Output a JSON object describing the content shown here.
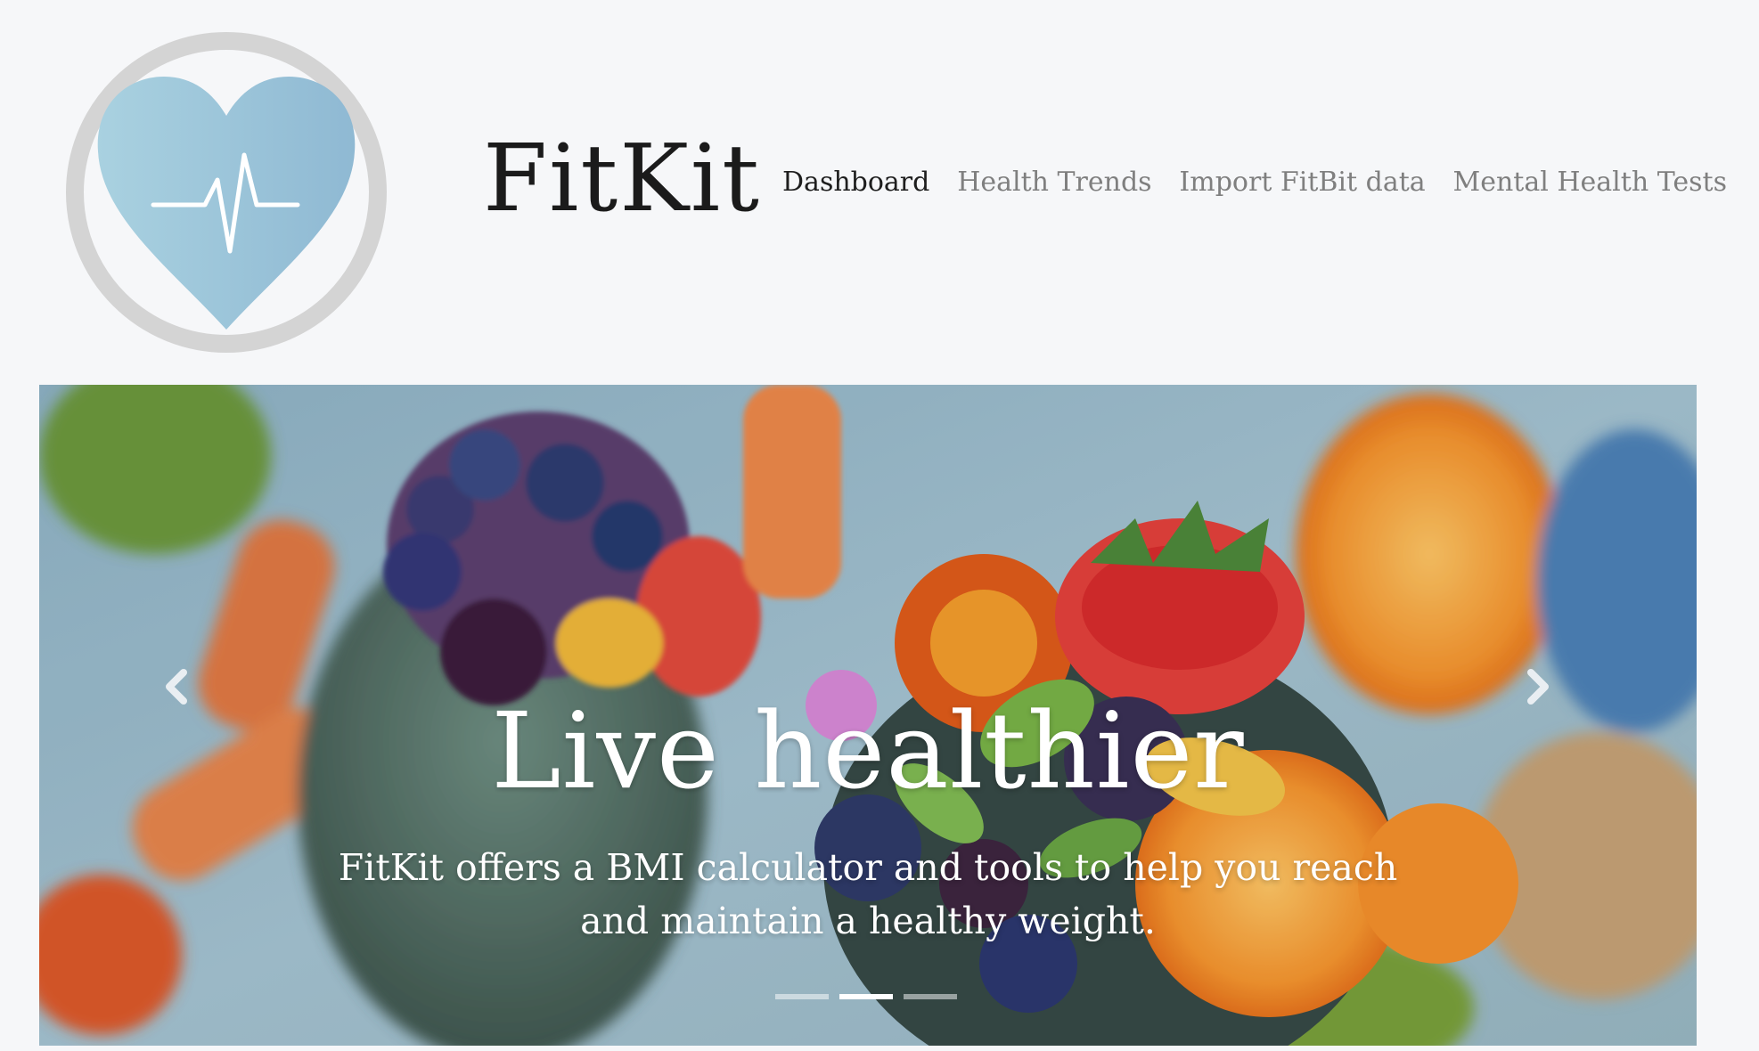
{
  "navbar": {
    "brand": "FitKit",
    "logo_icon": "heart-pulse-icon",
    "nav_items": [
      {
        "label": "Dashboard",
        "active": true
      },
      {
        "label": "Health Trends",
        "active": false
      },
      {
        "label": "Import FitBit data",
        "active": false
      },
      {
        "label": "Mental Health Tests",
        "active": false
      }
    ]
  },
  "carousel": {
    "title": "Live healthier",
    "caption": "FitKit offers a BMI calculator and tools to help you reach and maintain a healthy weight.",
    "prev_icon": "chevron-left-icon",
    "next_icon": "chevron-right-icon",
    "slide_count": 3,
    "active_index": 1
  },
  "colors": {
    "header_bg": "#f6f7f9",
    "nav_active": "#1e1e1e",
    "nav_inactive": "#7f7f7f",
    "heart": "#9fc6da",
    "logo_ring": "#d3d3d3"
  }
}
